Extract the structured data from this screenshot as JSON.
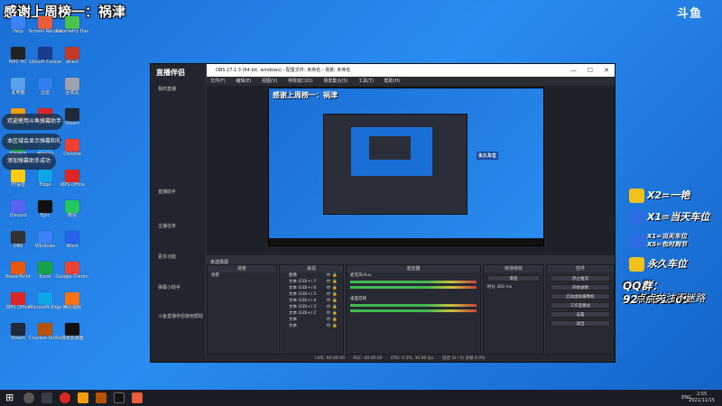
{
  "stream": {
    "title": "感谢上周榜一：祸津",
    "logo": "斗鱼"
  },
  "desktop_icons": [
    {
      "label": "Help",
      "color": "#3b82f6"
    },
    {
      "label": "Screen Recorder",
      "color": "#e85d3c"
    },
    {
      "label": "Geometry Dash",
      "color": "#4cc24c"
    },
    {
      "label": "MPC-HC",
      "color": "#222"
    },
    {
      "label": "Ubisoft Connect",
      "color": "#1b3c8c"
    },
    {
      "label": "direct",
      "color": "#c0392b"
    },
    {
      "label": "此电脑",
      "color": "#5aa0e8"
    },
    {
      "label": "迅雷",
      "color": "#2f80ed"
    },
    {
      "label": "回收站",
      "color": "#9ca3af"
    },
    {
      "label": "鲁大师",
      "color": "#f59e0b"
    },
    {
      "label": "网易云",
      "color": "#dc2626"
    },
    {
      "label": "Steam",
      "color": "#1f2937"
    },
    {
      "label": "控制面板",
      "color": "#16a34a"
    },
    {
      "label": "腾讯QQ",
      "color": "#1d9bf0"
    },
    {
      "label": "Chrome",
      "color": "#ea4335"
    },
    {
      "label": "YY语音",
      "color": "#facc15"
    },
    {
      "label": "Edge",
      "color": "#0ea5e9"
    },
    {
      "label": "WPS Office",
      "color": "#dc2626"
    },
    {
      "label": "Discord",
      "color": "#5865f2"
    },
    {
      "label": "Epic",
      "color": "#111"
    },
    {
      "label": "微信",
      "color": "#22c55e"
    },
    {
      "label": "OBS",
      "color": "#333"
    },
    {
      "label": "Windows",
      "color": "#3b82f6"
    },
    {
      "label": "Word",
      "color": "#2563eb"
    },
    {
      "label": "PowerPoint",
      "color": "#ea580c"
    },
    {
      "label": "Excel",
      "color": "#16a34a"
    },
    {
      "label": "Google Chrome",
      "color": "#ea4335"
    },
    {
      "label": "WPS Office",
      "color": "#dc2626"
    },
    {
      "label": "Microsoft Edge",
      "color": "#0ea5e9"
    },
    {
      "label": "腾讯视频",
      "color": "#f97316"
    },
    {
      "label": "Steam",
      "color": "#1f2937"
    },
    {
      "label": "Counter-Strike",
      "color": "#b45309"
    },
    {
      "label": "游戏加速器",
      "color": "#111"
    }
  ],
  "notifications": [
    "欢迎使用斗鱼弹幕助手",
    "本区域会显示弹幕和礼物消息",
    "添加弹幕助手成功"
  ],
  "app": {
    "name": "直播伴侣",
    "side_items": [
      "我的直播",
      "直播助手",
      "主播任务",
      "更多功能",
      "弹幕小助手"
    ],
    "side_bottom": "斗鱼直播伴侣使用帮助"
  },
  "obs": {
    "title": "OBS 27.1.3 (64-bit, windows) - 配置文件: 未命名 - 场景: 未命名",
    "menu": [
      "文件(F)",
      "编辑(E)",
      "视图(V)",
      "停靠窗口(D)",
      "场景集合(S)",
      "工具(T)",
      "帮助(H)"
    ],
    "scene_label": "未选择源",
    "docks": {
      "scenes": {
        "title": "场景",
        "items": [
          "场景"
        ]
      },
      "sources": {
        "title": "来源",
        "items": [
          "图像",
          "文本 (GDI+) 7",
          "文本 (GDI+) 6",
          "文本 (GDI+) 5",
          "文本 (GDI+) 4",
          "文本 (GDI+) 3",
          "文本 (GDI+) 2",
          "文本",
          "文本"
        ]
      },
      "mixer": {
        "title": "混音器",
        "channels": [
          {
            "name": "麦克风/Aux",
            "db": "0.0 dB"
          },
          {
            "name": "桌面音频",
            "db": "0.0 dB"
          }
        ]
      },
      "transitions": {
        "title": "转场特效",
        "type": "渐变",
        "duration_label": "时长",
        "duration": "300 ms"
      },
      "controls": {
        "title": "控件",
        "buttons": [
          "停止推流",
          "开始录制",
          "启动虚拟摄像机",
          "工作室模式",
          "设置",
          "退出"
        ]
      }
    },
    "status": {
      "live": "LIVE: 00:00:00",
      "rec": "REC: 00:00:00",
      "cpu": "CPU: 0.5%, 30.00 fps",
      "kbps": "延迟 (0 / 0) 丢帧 0.0%"
    }
  },
  "overlay": {
    "badges": [
      "X2=一艳",
      "X1=当天车位",
      "X1=当天车位",
      "X5=包时到节",
      "永久车位"
    ],
    "qq_label": "QQ群：",
    "qq_number": "927931309",
    "sub": "点点关注不迷路"
  },
  "taskbar": {
    "lang": "ENG",
    "time": "2:55",
    "date": "2021/11/15"
  }
}
